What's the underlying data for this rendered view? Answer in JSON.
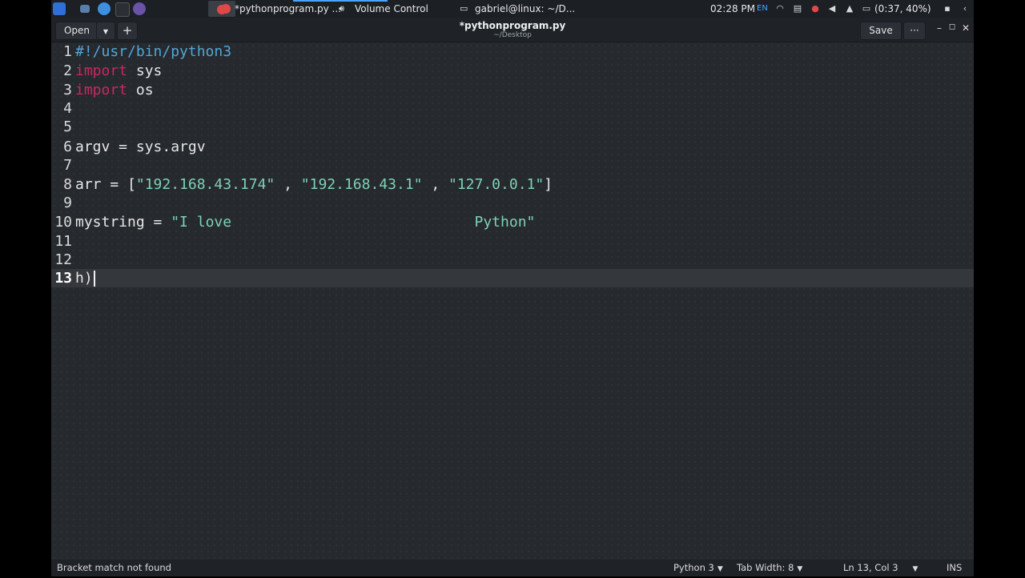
{
  "taskbar": {
    "tasks": [
      {
        "label": "*pythonprogram.py ..."
      },
      {
        "label": "Volume Control"
      },
      {
        "label": "gabriel@linux: ~/D..."
      }
    ],
    "clock": "02:28 PM",
    "keyboard_layout": "EN",
    "battery": "(0:37, 40%)"
  },
  "header": {
    "open_label": "Open",
    "new_tab_label": "+",
    "title": "*pythonprogram.py",
    "subtitle": "~/Desktop",
    "save_label": "Save",
    "menu_label": "···"
  },
  "editor": {
    "language": "Python 3",
    "current_line": 13,
    "lines": [
      {
        "num": "1",
        "parts": [
          {
            "t": "#!/usr/bin/python3",
            "c": "cmt"
          }
        ]
      },
      {
        "num": "2",
        "parts": [
          {
            "t": "import",
            "c": "kw"
          },
          {
            "t": " sys",
            "c": ""
          }
        ]
      },
      {
        "num": "3",
        "parts": [
          {
            "t": "import",
            "c": "kw"
          },
          {
            "t": " os",
            "c": ""
          }
        ]
      },
      {
        "num": "4",
        "parts": []
      },
      {
        "num": "5",
        "parts": []
      },
      {
        "num": "6",
        "parts": [
          {
            "t": "argv = sys.argv",
            "c": ""
          }
        ]
      },
      {
        "num": "7",
        "parts": []
      },
      {
        "num": "8",
        "parts": [
          {
            "t": "arr = [",
            "c": ""
          },
          {
            "t": "\"192.168.43.174\"",
            "c": "str"
          },
          {
            "t": " , ",
            "c": ""
          },
          {
            "t": "\"192.168.43.1\"",
            "c": "str"
          },
          {
            "t": " , ",
            "c": ""
          },
          {
            "t": "\"127.0.0.1\"",
            "c": "str"
          },
          {
            "t": "]",
            "c": ""
          }
        ]
      },
      {
        "num": "9",
        "parts": []
      },
      {
        "num": "10",
        "parts": [
          {
            "t": "mystring = ",
            "c": ""
          },
          {
            "t": "\"I love                            Python\"",
            "c": "str"
          }
        ]
      },
      {
        "num": "11",
        "parts": []
      },
      {
        "num": "12",
        "parts": []
      },
      {
        "num": "13",
        "parts": [
          {
            "t": "h)",
            "c": ""
          }
        ]
      }
    ]
  },
  "statusbar": {
    "message": "Bracket match not found",
    "language": "Python 3",
    "tab_width": "Tab Width: 8",
    "position": "Ln 13, Col 3",
    "mode": "INS"
  },
  "colors": {
    "keyword": "#c9285e",
    "string": "#7fd0b2",
    "comment": "#52a6d6",
    "editor_bg": "#262a2f"
  }
}
